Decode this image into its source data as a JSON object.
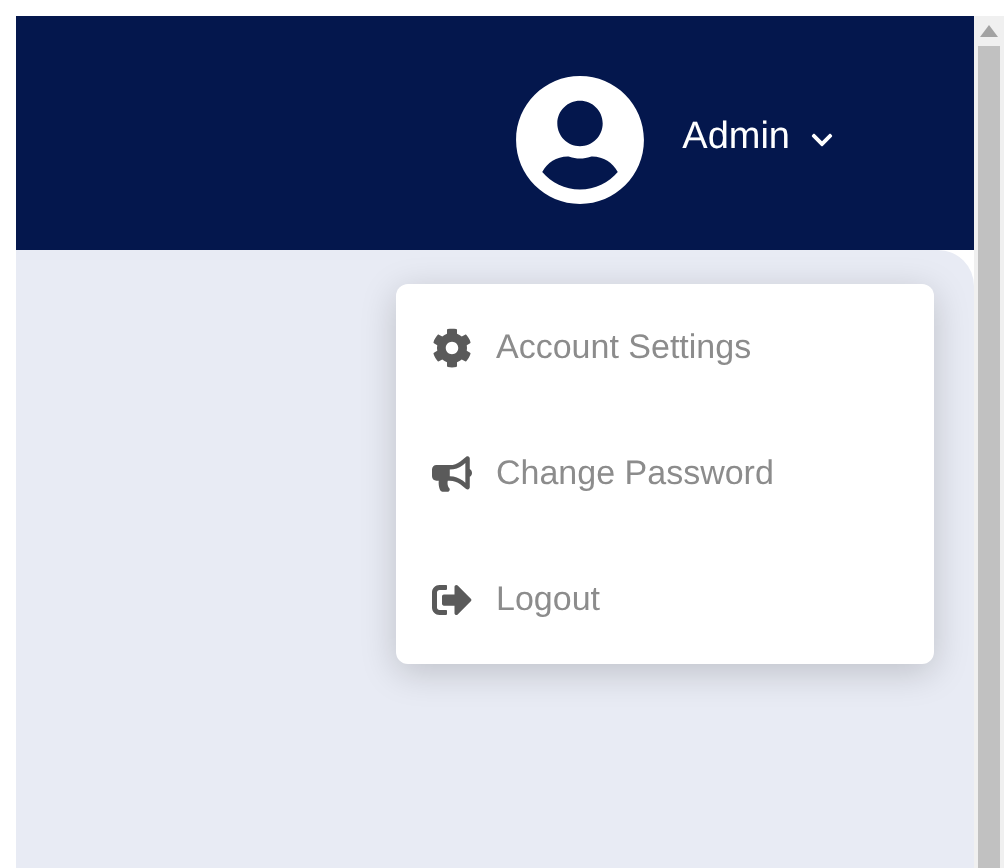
{
  "header": {
    "user": {
      "name": "Admin",
      "menu_open": true
    }
  },
  "dropdown": {
    "items": [
      {
        "kind": "settings",
        "label": "Account Settings"
      },
      {
        "kind": "password",
        "label": "Change Password"
      },
      {
        "kind": "logout",
        "label": "Logout"
      }
    ]
  }
}
